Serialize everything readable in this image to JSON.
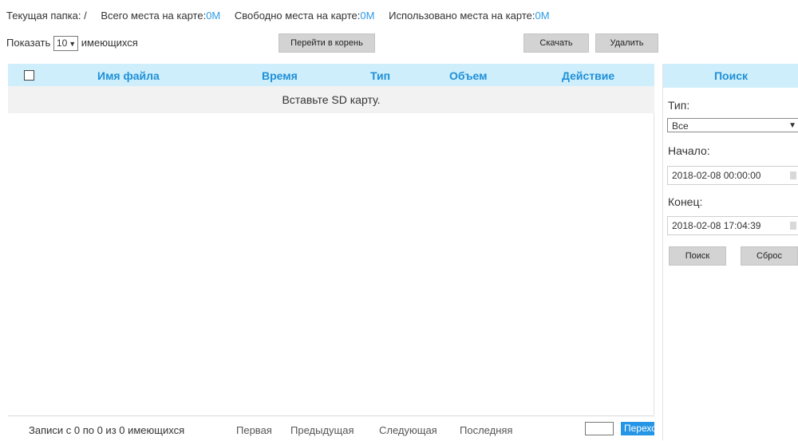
{
  "info": {
    "current_folder_label": "Текущая папка:",
    "current_folder_value": "/",
    "total_label": "Всего места на карте:",
    "total_value": "0M",
    "free_label": "Свободно места на карте:",
    "free_value": "0M",
    "used_label": "Использовано места на карте:",
    "used_value": "0M"
  },
  "toolbar": {
    "show_label": "Показать",
    "page_size": "10",
    "show_suffix": "имеющихся",
    "root_button": "Перейти в корень",
    "download_button": "Скачать",
    "delete_button": "Удалить"
  },
  "table": {
    "headers": {
      "filename": "Имя файла",
      "time": "Время",
      "type": "Тип",
      "size": "Объем",
      "action": "Действие"
    },
    "empty_message": "Вставьте SD карту."
  },
  "pager": {
    "info": "Записи с 0 по 0 из 0 имеющихся",
    "first": "Первая",
    "prev": "Предыдущая",
    "next": "Следующая",
    "last": "Последняя",
    "goto": "Переход"
  },
  "search": {
    "title": "Поиск",
    "type_label": "Тип:",
    "type_value": "Все",
    "start_label": "Начало:",
    "start_value": "2018-02-08 00:00:00",
    "end_label": "Конец:",
    "end_value": "2018-02-08 17:04:39",
    "search_button": "Поиск",
    "reset_button": "Сброс"
  },
  "colors": {
    "accent": "#1e90d8",
    "header_bg": "#cfeefb",
    "button_bg": "#d3d3d3",
    "go_button_bg": "#2596e6"
  }
}
